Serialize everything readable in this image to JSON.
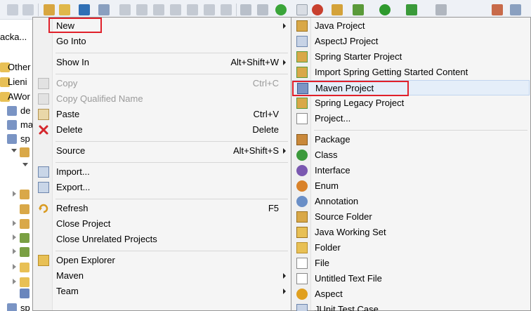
{
  "explorer": {
    "items": [
      {
        "label": "acka..."
      },
      {
        "label": "Other"
      },
      {
        "label": "Lieni"
      },
      {
        "label": "AWor"
      },
      {
        "label": "de"
      },
      {
        "label": "ma"
      },
      {
        "label": "sp"
      },
      {
        "label": "sp"
      }
    ]
  },
  "context_menu": {
    "items": [
      {
        "label": "New",
        "accel": ""
      },
      {
        "label": "Go Into",
        "accel": ""
      },
      {
        "label": "Show In",
        "accel": "Alt+Shift+W"
      },
      {
        "label": "Copy",
        "accel": "Ctrl+C"
      },
      {
        "label": "Copy Qualified Name",
        "accel": ""
      },
      {
        "label": "Paste",
        "accel": "Ctrl+V"
      },
      {
        "label": "Delete",
        "accel": "Delete"
      },
      {
        "label": "Source",
        "accel": "Alt+Shift+S"
      },
      {
        "label": "Import...",
        "accel": ""
      },
      {
        "label": "Export...",
        "accel": ""
      },
      {
        "label": "Refresh",
        "accel": "F5"
      },
      {
        "label": "Close Project",
        "accel": ""
      },
      {
        "label": "Close Unrelated Projects",
        "accel": ""
      },
      {
        "label": "Open Explorer",
        "accel": ""
      },
      {
        "label": "Maven",
        "accel": ""
      },
      {
        "label": "Team",
        "accel": ""
      }
    ]
  },
  "new_submenu": {
    "items": [
      {
        "label": "Java Project"
      },
      {
        "label": "AspectJ Project"
      },
      {
        "label": "Spring Starter Project"
      },
      {
        "label": "Import Spring Getting Started Content"
      },
      {
        "label": "Maven Project"
      },
      {
        "label": "Spring Legacy Project"
      },
      {
        "label": "Project..."
      },
      {
        "label": "Package"
      },
      {
        "label": "Class"
      },
      {
        "label": "Interface"
      },
      {
        "label": "Enum"
      },
      {
        "label": "Annotation"
      },
      {
        "label": "Source Folder"
      },
      {
        "label": "Java Working Set"
      },
      {
        "label": "Folder"
      },
      {
        "label": "File"
      },
      {
        "label": "Untitled Text File"
      },
      {
        "label": "Aspect"
      },
      {
        "label": "JUnit Test Case"
      }
    ]
  },
  "colors": {
    "highlight_box": "#e0202a",
    "menu_bg": "#f5f5f5",
    "hover_bg": "#e5eef9"
  }
}
